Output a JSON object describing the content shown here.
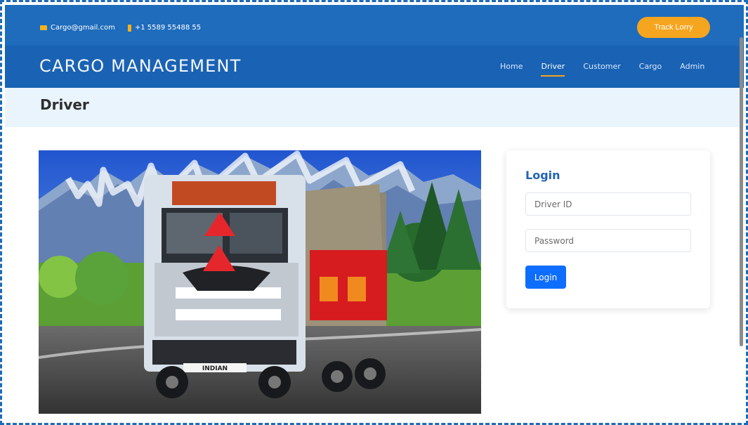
{
  "contact": {
    "email": "Cargo@gmail.com",
    "phone": "+1 5589 55488 55"
  },
  "top_button": "Track Lorry",
  "brand": "CARGO MANAGEMENT",
  "nav": [
    "Home",
    "Driver",
    "Customer",
    "Cargo",
    "Admin"
  ],
  "active_nav": "Driver",
  "page_title": "Driver",
  "login": {
    "title": "Login",
    "driver_placeholder": "Driver ID",
    "password_placeholder": "Password",
    "button": "Login"
  },
  "truck_plate": "INDIAN",
  "colors": {
    "topbar": "#1f6cbc",
    "header": "#1a62b3",
    "accent": "#f6a51f",
    "primary_button": "#0d6efd"
  }
}
